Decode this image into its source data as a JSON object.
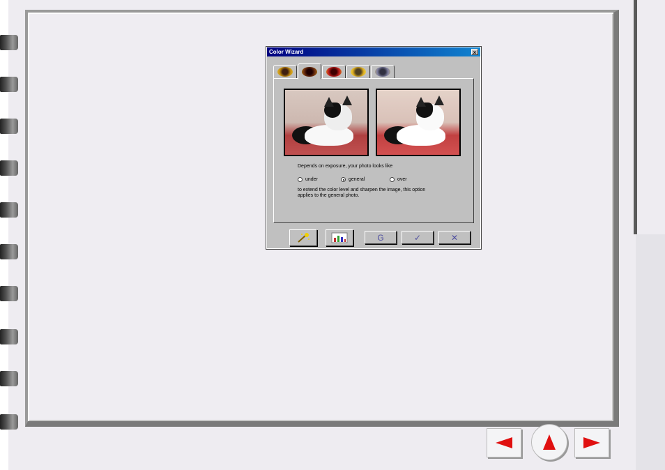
{
  "dialog": {
    "title": "Color Wizard",
    "close_glyph": "×",
    "tabs": [
      {
        "icon": "sunflower-icon",
        "color": "#c89010"
      },
      {
        "icon": "sunflower-dark-icon",
        "color": "#703010"
      },
      {
        "icon": "sunflower-red-icon",
        "color": "#c02020"
      },
      {
        "icon": "sunflower-yellow-icon",
        "color": "#e0b020"
      },
      {
        "icon": "sunflower-gray-icon",
        "color": "#8080a0"
      }
    ],
    "exposure_prompt": "Depends on exposure, your photo looks like",
    "options": [
      {
        "label": "under",
        "checked": false
      },
      {
        "label": "general",
        "checked": true
      },
      {
        "label": "over",
        "checked": false
      }
    ],
    "description_line1": "to extend the color level and sharpen the image, this option",
    "description_line2": "applies to the general photo.",
    "buttons": {
      "wand": "magic-wand-icon",
      "histogram": "histogram-icon",
      "reset_glyph": "G",
      "ok_glyph": "✓",
      "cancel_glyph": "✕"
    }
  },
  "nav": {
    "prev": "prev-page-icon",
    "home": "home-up-icon",
    "next": "next-page-icon",
    "accent": "#e01010"
  }
}
